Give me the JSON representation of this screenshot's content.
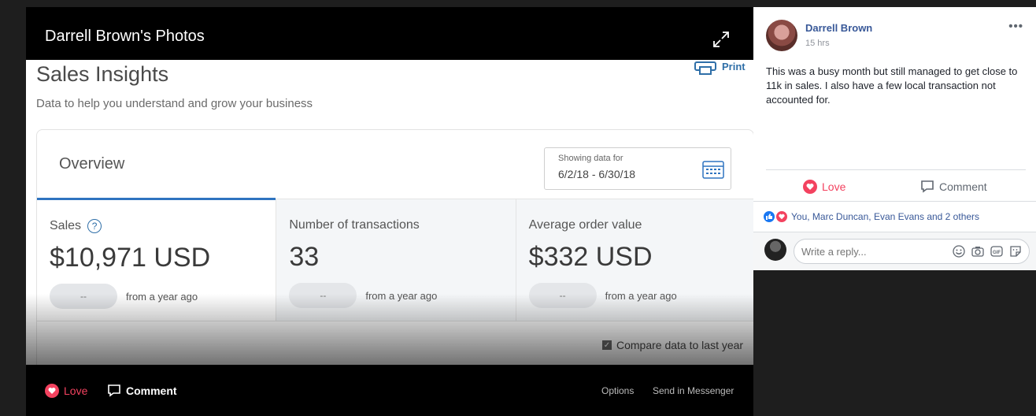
{
  "viewer": {
    "title": "Darrell Brown's Photos",
    "bottom_bar": {
      "love": "Love",
      "comment": "Comment",
      "options": "Options",
      "send_in_messenger": "Send in Messenger"
    }
  },
  "photo": {
    "title": "Sales Insights",
    "subtitle": "Data to help you understand and grow your business",
    "print": "Print",
    "overview": "Overview",
    "date_label": "Showing data for",
    "date_range": "6/2/18 - 6/30/18",
    "metrics": [
      {
        "label": "Sales",
        "value": "$10,971 USD",
        "pill": "--",
        "compare": "from a year ago"
      },
      {
        "label": "Number of transactions",
        "value": "33",
        "pill": "--",
        "compare": "from a year ago"
      },
      {
        "label": "Average order value",
        "value": "$332 USD",
        "pill": "--",
        "compare": "from a year ago"
      }
    ],
    "compare_checkbox": "Compare data to last year"
  },
  "sidebar": {
    "author": "Darrell Brown",
    "time": "15 hrs",
    "post_text": "This was a busy month but still managed to get close to 11k in sales. I also have a few local transaction not accounted for.",
    "love": "Love",
    "comment": "Comment",
    "reactions_text": "You, Marc Duncan, Evan Evans and 2 others",
    "reply_placeholder": "Write a reply..."
  },
  "colors": {
    "love": "#f3425f",
    "link": "#385898",
    "accent": "#2f74c0"
  }
}
